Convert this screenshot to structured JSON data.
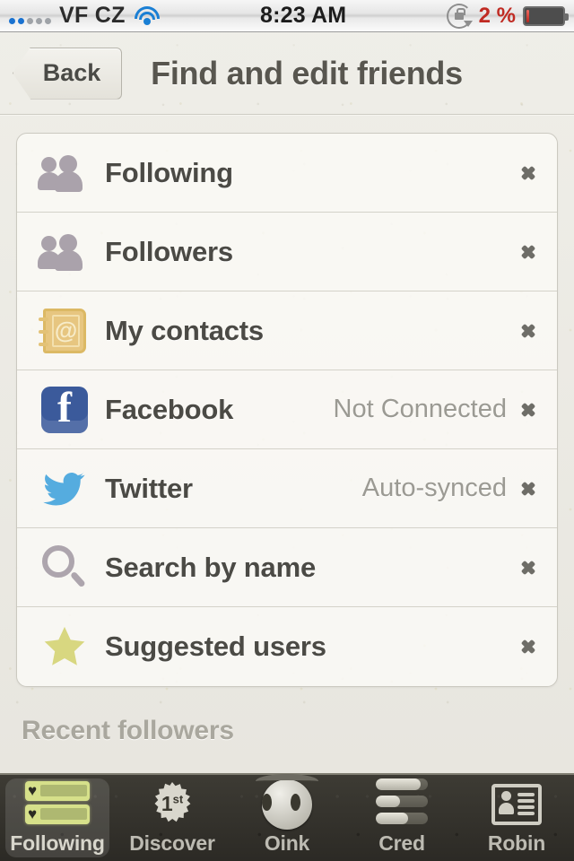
{
  "status_bar": {
    "carrier": "VF CZ",
    "signal_bars_filled": 2,
    "signal_bars_total": 5,
    "wifi_icon": "wifi-icon",
    "time": "8:23 AM",
    "rotation_lock_icon": "rotation-lock-icon",
    "battery_percent": "2 %",
    "battery_level": 8,
    "battery_color": "#b8241c"
  },
  "nav": {
    "back_label": "Back",
    "title": "Find and edit friends"
  },
  "list": {
    "rows": [
      {
        "icon": "people-icon",
        "label": "Following",
        "status": ""
      },
      {
        "icon": "people-icon",
        "label": "Followers",
        "status": ""
      },
      {
        "icon": "address-book-icon",
        "label": "My contacts",
        "status": ""
      },
      {
        "icon": "facebook-icon",
        "label": "Facebook",
        "status": "Not Connected"
      },
      {
        "icon": "twitter-bird-icon",
        "label": "Twitter",
        "status": "Auto-synced"
      },
      {
        "icon": "magnifier-icon",
        "label": "Search by name",
        "status": ""
      },
      {
        "icon": "star-icon",
        "label": "Suggested users",
        "status": ""
      }
    ]
  },
  "section": {
    "recent_followers_header": "Recent followers"
  },
  "tabbar": {
    "tabs": [
      {
        "icon": "following-list-icon",
        "label": "Following",
        "active": true
      },
      {
        "icon": "first-place-badge-icon",
        "label": "Discover",
        "active": false
      },
      {
        "icon": "pig-snout-icon",
        "label": "Oink",
        "active": false
      },
      {
        "icon": "cred-bars-icon",
        "label": "Cred",
        "active": false
      },
      {
        "icon": "contact-card-icon",
        "label": "Robin",
        "active": false
      }
    ],
    "discover_badge_text": "1",
    "discover_badge_suffix": "st"
  },
  "colors": {
    "paper": "#eceae4",
    "card": "#faf9f5",
    "label_text": "#4b4a45",
    "status_text": "#9b9a93",
    "title_text": "#58564f",
    "chevron": "#6e6d67",
    "facebook_blue": "#3b5a9b",
    "twitter_blue": "#55acdf",
    "book_tan": "#e7c680",
    "star_khaki": "#d8d780",
    "people_mauve": "#aaa2ab",
    "tabbar_dark": "#35332d",
    "tab_accent": "#d6e08a"
  }
}
